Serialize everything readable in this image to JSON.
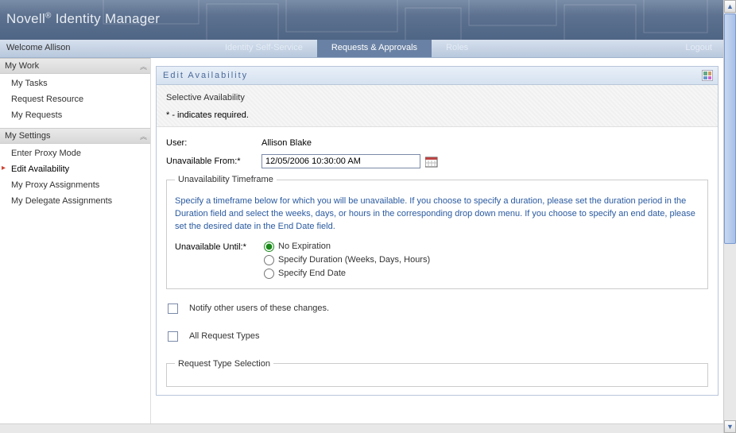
{
  "app": {
    "brand": "Novell",
    "title": "Identity Manager"
  },
  "topbar": {
    "welcome": "Welcome Allison",
    "tabs": [
      {
        "label": "Identity Self-Service"
      },
      {
        "label": "Requests & Approvals"
      },
      {
        "label": "Roles"
      }
    ],
    "logout": "Logout"
  },
  "sidebar": {
    "sections": [
      {
        "title": "My Work",
        "items": [
          {
            "label": "My Tasks"
          },
          {
            "label": "Request Resource"
          },
          {
            "label": "My Requests"
          }
        ]
      },
      {
        "title": "My Settings",
        "items": [
          {
            "label": "Enter Proxy Mode"
          },
          {
            "label": "Edit Availability"
          },
          {
            "label": "My Proxy Assignments"
          },
          {
            "label": "My Delegate Assignments"
          }
        ]
      }
    ]
  },
  "panel": {
    "title": "Edit Availability",
    "section_title": "Selective Availability",
    "required_note": "* - indicates required.",
    "user_label": "User:",
    "user_value": "Allison Blake",
    "unavailable_from_label": "Unavailable From:*",
    "unavailable_from_value": "12/05/2006 10:30:00 AM",
    "timeframe": {
      "legend": "Unavailability Timeframe",
      "desc": "Specify a timeframe below for which you will be unavailable. If you choose to specify a duration, please set the duration period in the Duration field and select the weeks, days, or hours in the corresponding drop down menu. If you choose to specify an end date, please set the desired date in the End Date field.",
      "until_label": "Unavailable Until:*",
      "options": [
        "No Expiration",
        "Specify Duration (Weeks, Days, Hours)",
        "Specify End Date"
      ],
      "selected": 0
    },
    "notify_label": "Notify other users of these changes.",
    "all_request_types_label": "All Request Types",
    "request_type_selection_legend": "Request Type Selection"
  }
}
